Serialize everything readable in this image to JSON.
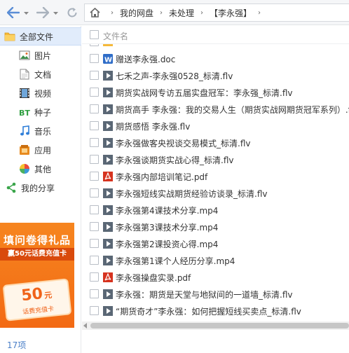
{
  "toolbar": {
    "back_icon": "back-arrow-icon",
    "forward_icon": "forward-arrow-icon",
    "refresh_icon": "refresh-icon",
    "breadcrumb": [
      "我的网盘",
      "未处理",
      "【李永强】"
    ],
    "separator": "›"
  },
  "sidebar": {
    "items": [
      {
        "label": "全部文件",
        "icon": "folder-icon",
        "active": true
      },
      {
        "label": "图片",
        "icon": "image-icon"
      },
      {
        "label": "文档",
        "icon": "document-icon"
      },
      {
        "label": "视频",
        "icon": "video-icon"
      },
      {
        "label": "种子",
        "icon": "bt-icon"
      },
      {
        "label": "音乐",
        "icon": "music-icon"
      },
      {
        "label": "应用",
        "icon": "app-icon"
      },
      {
        "label": "其他",
        "icon": "other-icon"
      },
      {
        "label": "我的分享",
        "icon": "share-icon"
      }
    ]
  },
  "promo": {
    "title": "填问卷得礼品",
    "subtitle": "赢50元话费充值卡",
    "amount": "50",
    "unit": "元",
    "card_label": "话费充值卡"
  },
  "list": {
    "header": "文件名",
    "files": [
      {
        "name": "赠送李永强.doc",
        "type": "doc"
      },
      {
        "name": "七禾之声-李永强0528_标清.flv",
        "type": "video"
      },
      {
        "name": "期货实战网专访五届实盘冠军：李永强_标清.flv",
        "type": "video"
      },
      {
        "name": "期货高手 李永强：我的交易人生（期货实战网期货冠军系列）.flv",
        "type": "video"
      },
      {
        "name": "期货感悟 李永强.flv",
        "type": "video"
      },
      {
        "name": "李永强做客央视谈交易模式_标清.flv",
        "type": "video"
      },
      {
        "name": "李永强谈期货实战心得_标清.flv",
        "type": "video"
      },
      {
        "name": "李永强内部培训笔记.pdf",
        "type": "pdf"
      },
      {
        "name": "李永强短线实战期货经验访谈录_标清.flv",
        "type": "video"
      },
      {
        "name": "李永强第4课技术分享.mp4",
        "type": "video"
      },
      {
        "name": "李永强第3课技术分享.mp4",
        "type": "video"
      },
      {
        "name": "李永强第2课投资心得.mp4",
        "type": "video"
      },
      {
        "name": "李永强第1课个人经历分享.mp4",
        "type": "video"
      },
      {
        "name": "李永强操盘实录.pdf",
        "type": "pdf"
      },
      {
        "name": "李永强：期货是天堂与地狱间的一道墙_标清.flv",
        "type": "video"
      },
      {
        "name": "“期货奇才”李永强：如何把握短线买卖点_标清.flv",
        "type": "video"
      }
    ]
  },
  "status": {
    "count": "17项"
  }
}
